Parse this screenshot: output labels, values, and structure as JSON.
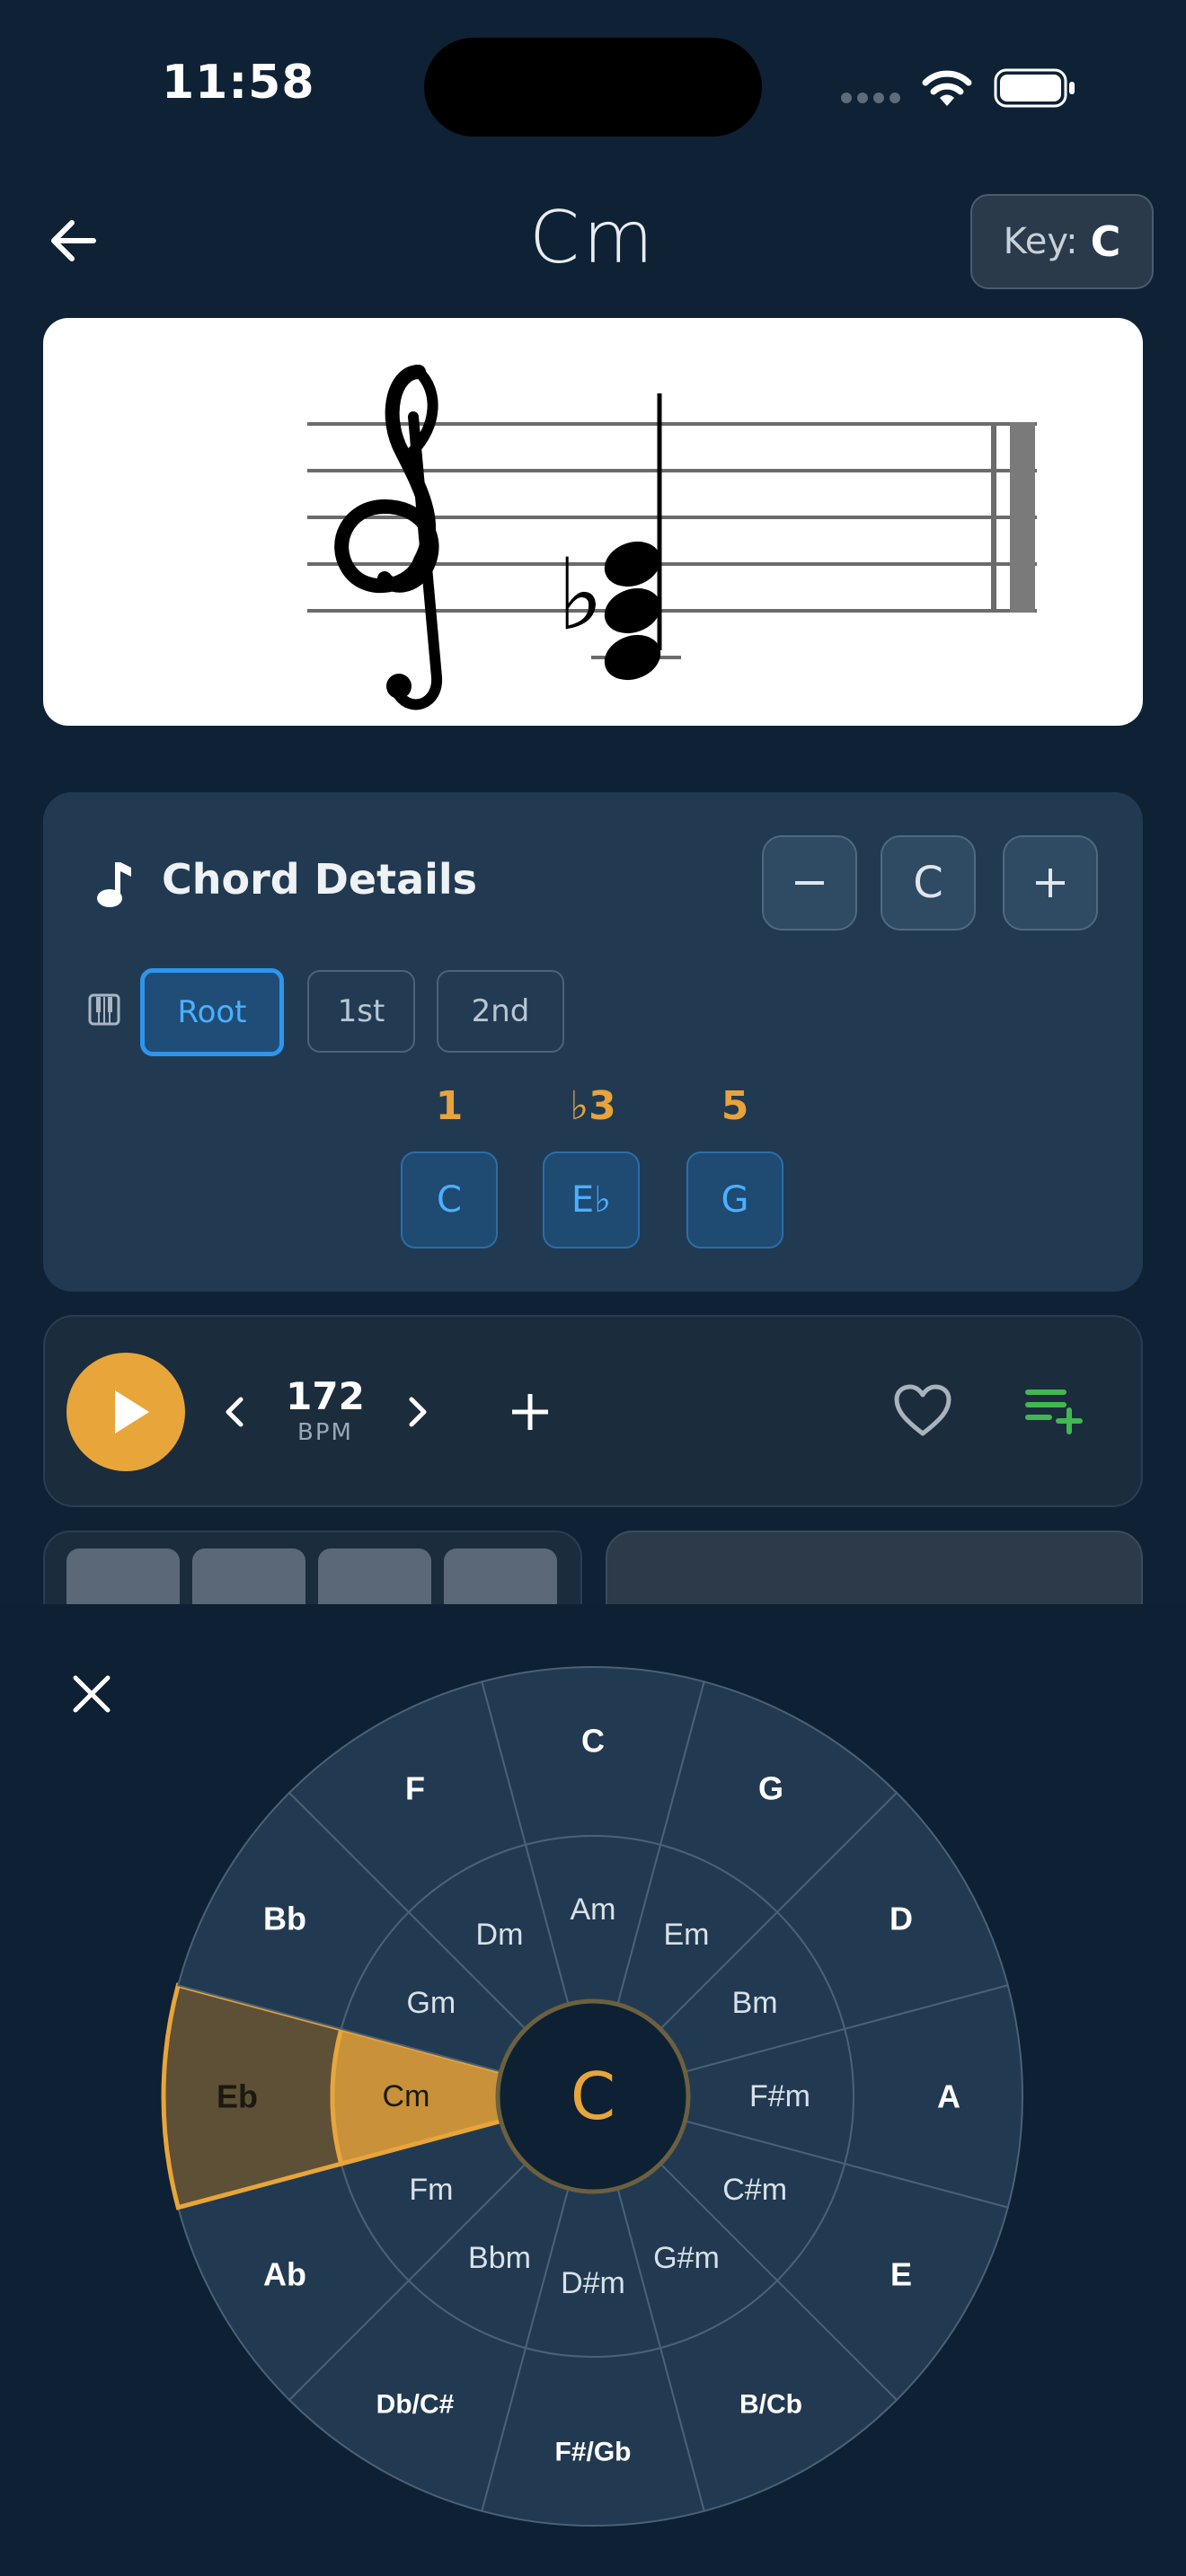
{
  "status_bar": {
    "time": "11:58"
  },
  "header": {
    "title": "Cm",
    "key_label": "Key:",
    "key_value": "C"
  },
  "chord_details": {
    "title": "Chord Details",
    "transpose_value": "C",
    "inversions": [
      "Root",
      "1st",
      "2nd"
    ],
    "active_inversion": "Root",
    "tones": [
      {
        "degree": "1",
        "note": "C"
      },
      {
        "degree": "♭3",
        "note": "E♭"
      },
      {
        "degree": "5",
        "note": "G"
      }
    ]
  },
  "playback": {
    "bpm": "172",
    "bpm_label": "BPM"
  },
  "circle_of_fifths": {
    "center_label": "C",
    "major_keys": [
      "C",
      "G",
      "D",
      "A",
      "E",
      "B/Cb",
      "F#/Gb",
      "Db/C#",
      "Ab",
      "Eb",
      "Bb",
      "F"
    ],
    "minor_keys": [
      "Am",
      "Em",
      "Bm",
      "F#m",
      "C#m",
      "G#m",
      "D#m",
      "Bbm",
      "Fm",
      "Cm",
      "Gm",
      "Dm"
    ],
    "selected_index": 9,
    "colors": {
      "segment": "#223a51",
      "segment_line": "#4a6176",
      "selected_outer": "#5e5036",
      "selected_inner": "#c8913a",
      "accent": "#e8a53a"
    }
  },
  "colors": {
    "background": "#0f2134",
    "accent_blue": "#2f95ec",
    "add_to_playlist": "#3fb950"
  }
}
